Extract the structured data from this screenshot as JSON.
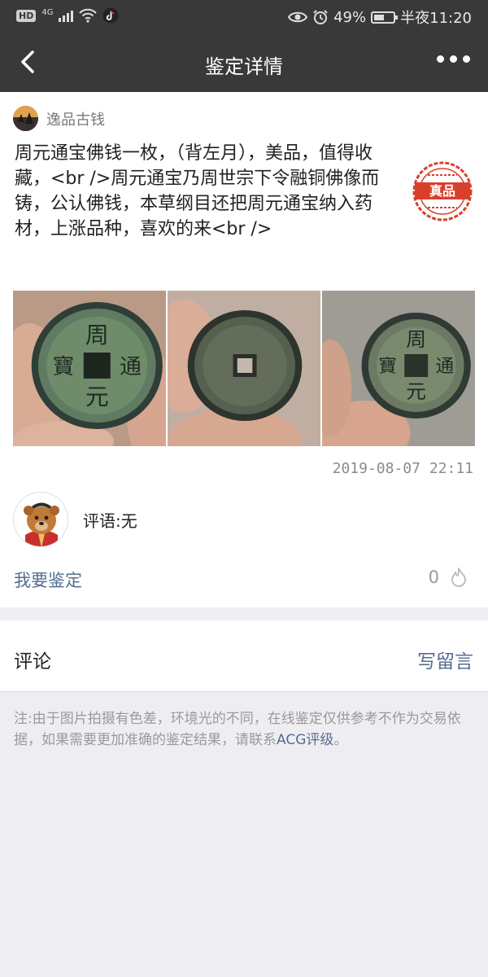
{
  "status_bar": {
    "hd": "HD",
    "network": "4G",
    "battery": "49%",
    "time": "半夜11:20"
  },
  "navbar": {
    "title": "鉴定详情",
    "back_icon": "back-arrow-icon",
    "more_icon": "more-dots-icon"
  },
  "post": {
    "author": "逸品古钱",
    "description": "周元通宝佛钱一枚，（背左月），美品，值得收藏，<br />周元通宝乃周世宗下令融铜佛像而铸，公认佛钱，本草纲目还把周元通宝纳入药材，上涨品种，喜欢的来<br />",
    "stamp_text": "真品",
    "stamp_color": "#d9402b",
    "photos": [
      "coin-front-photo",
      "coin-back-photo",
      "coin-angle-photo"
    ],
    "datetime": "2019-08-07 22:11"
  },
  "appraisal": {
    "comment": "评语:无",
    "request_link": "我要鉴定",
    "like_count": "0"
  },
  "comments": {
    "title": "评论",
    "write_link": "写留言"
  },
  "notice": {
    "text": "注:由于图片拍摄有色差，环境光的不同，在线鉴定仅供参考不作为交易依据，如果需要更加准确的鉴定结果，请联系",
    "link": "ACG评级",
    "tail": "。"
  },
  "colors": {
    "header_bg": "#393939",
    "link": "#566d8f",
    "page_bg": "#eeeef2"
  }
}
